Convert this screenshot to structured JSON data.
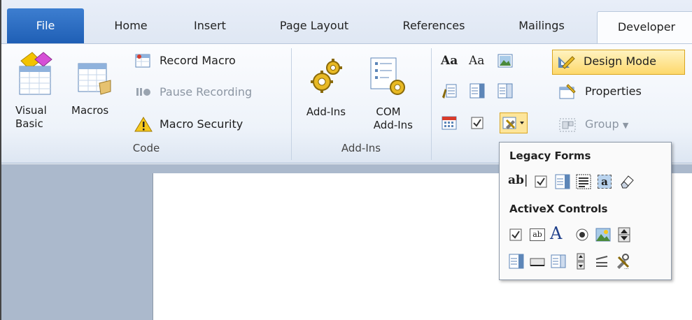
{
  "tabs": {
    "file": "File",
    "home": "Home",
    "insert": "Insert",
    "page_layout": "Page Layout",
    "references": "References",
    "mailings": "Mailings",
    "developer": "Developer"
  },
  "code_group": {
    "label": "Code",
    "visual_basic_line1": "Visual",
    "visual_basic_line2": "Basic",
    "macros": "Macros",
    "record_macro": "Record Macro",
    "pause_recording": "Pause Recording",
    "macro_security": "Macro Security"
  },
  "addins_group": {
    "label": "Add-Ins",
    "addins": "Add-Ins",
    "com_addins_line1": "COM",
    "com_addins_line2": "Add-Ins"
  },
  "controls_group": {
    "aa_rich": "Aa",
    "aa_plain": "Aa",
    "design_mode": "Design Mode",
    "properties": "Properties",
    "group": "Group"
  },
  "dropdown": {
    "legacy_header": "Legacy Forms",
    "activex_header": "ActiveX Controls",
    "legacy_ab": "ab",
    "legacy_a": "a",
    "activex_ab": "ab",
    "activex_A": "A"
  },
  "colors": {
    "file_tab": "#2a6bc3",
    "design_mode_highlight": "#fde59a",
    "ribbon_bg": "#eef3fa",
    "document_bg": "#abb9cc"
  }
}
